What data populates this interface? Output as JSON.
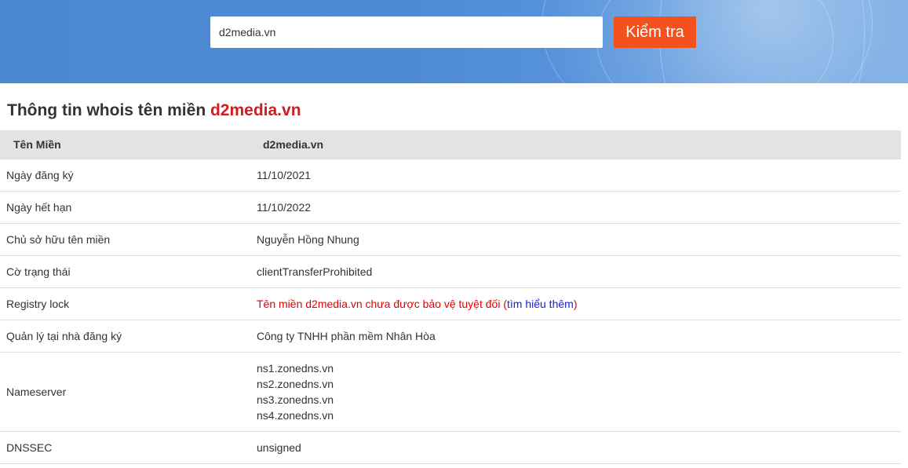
{
  "search": {
    "value": "d2media.vn",
    "button_label": "Kiểm tra"
  },
  "heading": {
    "prefix": "Thông tin whois tên miền ",
    "domain": "d2media.vn"
  },
  "table": {
    "header": {
      "label": "Tên Miền",
      "value": "d2media.vn"
    },
    "rows": [
      {
        "label": "Ngày đăng ký",
        "value": "11/10/2021"
      },
      {
        "label": "Ngày hết hạn",
        "value": "11/10/2022"
      },
      {
        "label": "Chủ sở hữu tên miền",
        "value": "Nguyễn Hồng Nhung"
      },
      {
        "label": "Cờ trạng thái",
        "value": "clientTransferProhibited"
      },
      {
        "label": "Registry lock",
        "value": "Tên miền d2media.vn chưa được bảo vệ tuyệt đối (",
        "link": "tìm hiểu thêm",
        "suffix": ")"
      },
      {
        "label": "Quản lý tại nhà đăng ký",
        "value": "Công ty TNHH phần mềm Nhân Hòa"
      },
      {
        "label": "Nameserver",
        "values": [
          "ns1.zonedns.vn",
          "ns2.zonedns.vn",
          "ns3.zonedns.vn",
          "ns4.zonedns.vn"
        ]
      },
      {
        "label": "DNSSEC",
        "value": "unsigned"
      }
    ]
  },
  "colors": {
    "banner": "#4f8ad6",
    "button": "#f4511e",
    "domain_heading": "#cc1f1f",
    "header_link": "#3a8fd0",
    "registry_warning": "#e00000",
    "learn_more_link": "#1a1ae6"
  }
}
